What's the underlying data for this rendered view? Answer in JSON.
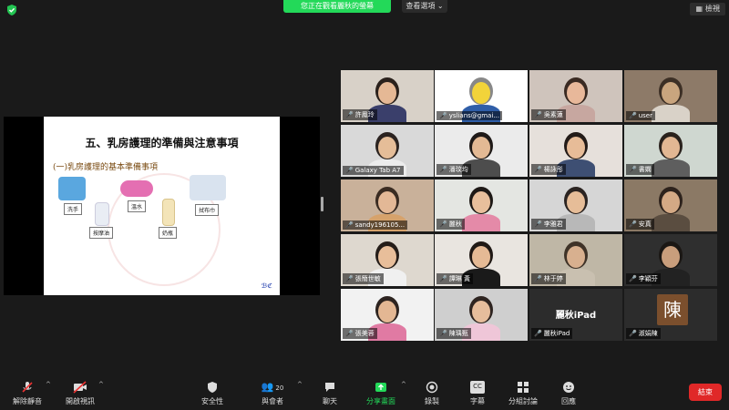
{
  "top": {
    "viewing_banner": "您正在觀看麗秋的螢幕",
    "view_options": "查看選項",
    "view_button": "檢視"
  },
  "slide": {
    "title": "五、乳房護理的準備與注意事項",
    "subtitle": "(一)乳房護理的基本準備事項",
    "labels": {
      "wash": "洗手",
      "hot_water": "溫水",
      "towel": "拭布巾",
      "massage_oil": "按摩油",
      "bottle": "奶瓶"
    }
  },
  "participants": [
    {
      "name": "許鳳玲"
    },
    {
      "name": "yslians@gmai..."
    },
    {
      "name": "吳素蓮"
    },
    {
      "name": "user"
    },
    {
      "name": "Galaxy Tab A7"
    },
    {
      "name": "潘玟均"
    },
    {
      "name": "楊詠彤"
    },
    {
      "name": "書嫻"
    },
    {
      "name": "sandy196105..."
    },
    {
      "name": "麗秋"
    },
    {
      "name": "李雅君"
    },
    {
      "name": "安真"
    },
    {
      "name": "張簡世敏"
    },
    {
      "name": "譚琳 黃"
    },
    {
      "name": "林于婷"
    },
    {
      "name": "李穎芬"
    },
    {
      "name": "張美蓉"
    },
    {
      "name": "陳瑀甄"
    },
    {
      "name": "麗秋iPad",
      "tile_text": "麗秋iPad"
    },
    {
      "name": "淑娟陳",
      "avatar_letter": "陳"
    }
  ],
  "toolbar": {
    "unmute": "解除靜音",
    "start_video": "開啟視訊",
    "security": "安全性",
    "participants": "與會者",
    "participants_count": "20",
    "chat": "聊天",
    "share_screen": "分享畫面",
    "record": "錄製",
    "captions": "字幕",
    "breakout": "分組討論",
    "reactions": "回應",
    "end": "結束"
  },
  "colors": {
    "banner_green": "#23d959",
    "active_tile_outline": "#c7e84b",
    "end_red": "#e02828",
    "share_green": "#23d959"
  }
}
